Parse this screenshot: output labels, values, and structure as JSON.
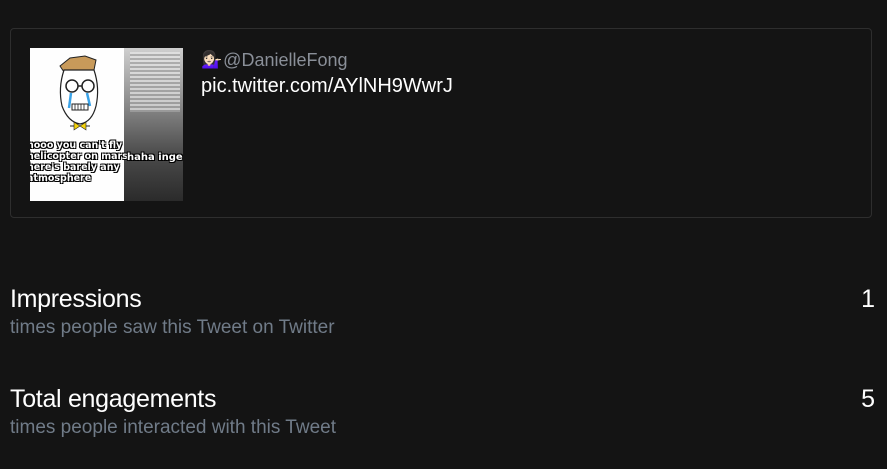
{
  "tweet": {
    "author_emoji": "💁🏻‍♀️",
    "author_handle": "@DanielleFong",
    "text": "pic.twitter.com/AYlNH9WwrJ",
    "image": {
      "caption_left": "nooo you can't fly\nhelicopter on mars\nhere's barely any\natmosphere",
      "caption_right": "haha inge"
    }
  },
  "metrics": [
    {
      "title": "Impressions",
      "subtitle": "times people saw this Tweet on Twitter",
      "value": "1"
    },
    {
      "title": "Total engagements",
      "subtitle": "times people interacted with this Tweet",
      "value": "5"
    }
  ],
  "colors": {
    "background": "#141414",
    "card_border": "#2e2e2e",
    "handle": "#8a8f98",
    "subtitle": "#707b88",
    "text": "#ffffff"
  }
}
